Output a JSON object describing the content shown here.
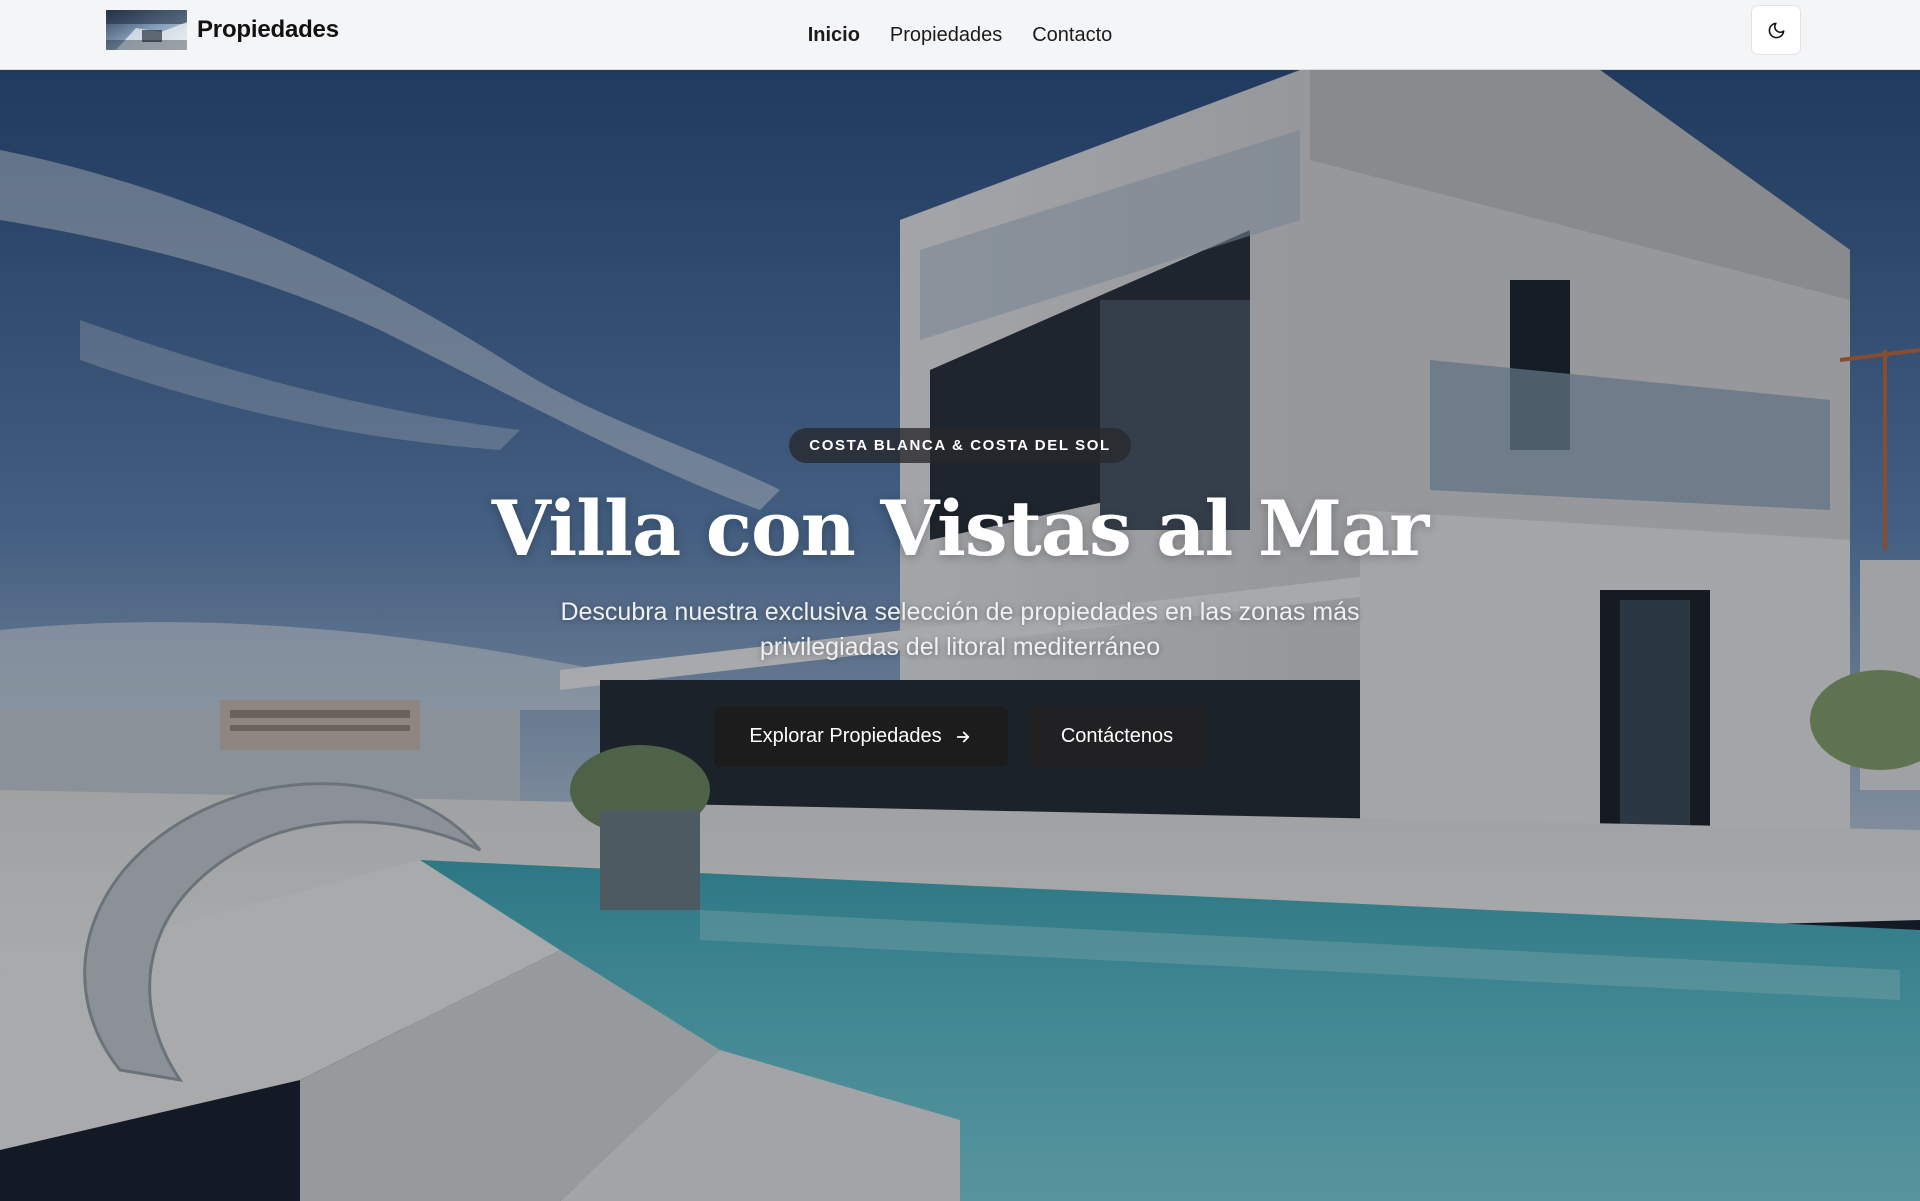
{
  "header": {
    "brand": "Propiedades",
    "nav": [
      {
        "label": "Inicio",
        "active": true
      },
      {
        "label": "Propiedades",
        "active": false
      },
      {
        "label": "Contacto",
        "active": false
      }
    ],
    "theme_toggle_icon": "moon-icon"
  },
  "hero": {
    "badge": "COSTA BLANCA & COSTA DEL SOL",
    "title": "Villa con Vistas al Mar",
    "subtitle": "Descubra nuestra exclusiva selección de propiedades en las zonas más privilegiadas del litoral mediterráneo",
    "primary_button": "Explorar Propiedades",
    "primary_button_icon": "arrow-right-icon",
    "secondary_button": "Contáctenos"
  },
  "colors": {
    "header_bg": "#f4f5f6",
    "button_dark": "#1c1c1c",
    "pool_blue": "#5bc0cc",
    "sky_blue": "#355a8a"
  }
}
